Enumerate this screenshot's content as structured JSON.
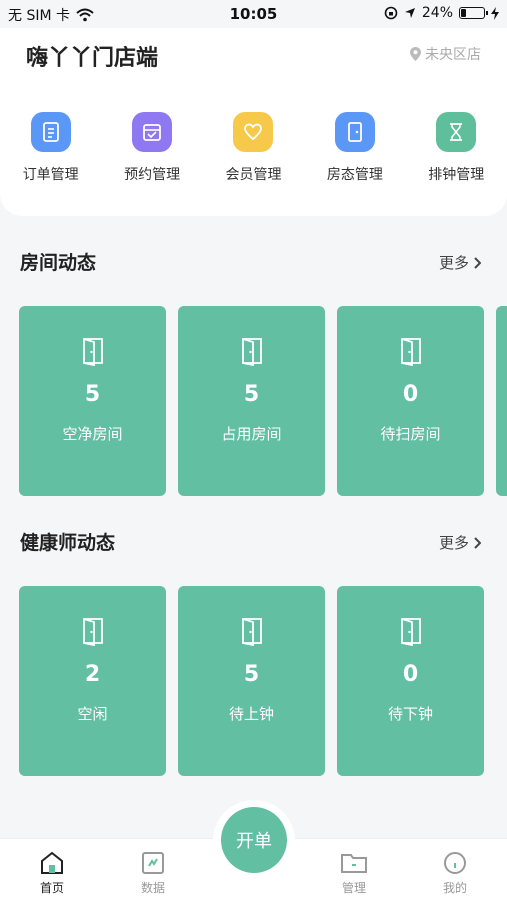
{
  "status_bar": {
    "carrier": "无 SIM 卡",
    "time": "10:05",
    "battery_text": "24%",
    "battery_level": 0.24
  },
  "header": {
    "store_name": "嗨丫丫门店端",
    "location": "未央区店"
  },
  "shortcuts": [
    {
      "label": "订单管理",
      "icon": "order-icon",
      "color": "#5b97f6"
    },
    {
      "label": "预约管理",
      "icon": "calendar-icon",
      "color": "#8f79f2"
    },
    {
      "label": "会员管理",
      "icon": "member-icon",
      "color": "#f6c94a"
    },
    {
      "label": "房态管理",
      "icon": "room-icon",
      "color": "#5b97f6"
    },
    {
      "label": "排钟管理",
      "icon": "hourglass-icon",
      "color": "#5fbf9c"
    }
  ],
  "room_section": {
    "title": "房间动态",
    "more": "更多",
    "cards": [
      {
        "value": "5",
        "label": "空净房间"
      },
      {
        "value": "5",
        "label": "占用房间"
      },
      {
        "value": "0",
        "label": "待扫房间"
      }
    ]
  },
  "therapist_section": {
    "title": "健康师动态",
    "more": "更多",
    "cards": [
      {
        "value": "2",
        "label": "空闲"
      },
      {
        "value": "5",
        "label": "待上钟"
      },
      {
        "value": "0",
        "label": "待下钟"
      }
    ]
  },
  "tabbar": {
    "home": "首页",
    "data": "数据",
    "action": "开单",
    "manage": "管理",
    "mine": "我的"
  },
  "colors": {
    "accent": "#63bfa2"
  }
}
